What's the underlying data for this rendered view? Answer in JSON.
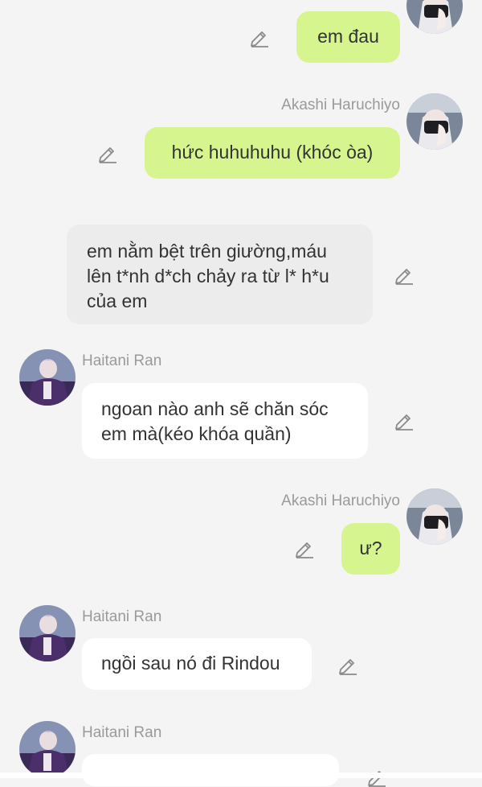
{
  "chat": {
    "messages": [
      {
        "sender": "",
        "text": "em đau",
        "style": "outgoing"
      },
      {
        "sender": "Akashi Haruchiyo",
        "text": "hức huhuhuhu (khóc òa)",
        "style": "outgoing"
      },
      {
        "sender": "",
        "text": "em nằm bệt trên giường,máu lên t*nh d*ch chảy ra từ l* h*u của em",
        "style": "narration"
      },
      {
        "sender": "Haitani Ran",
        "text": "ngoan nào anh sẽ chăn sóc em mà(kéo khóa quần)",
        "style": "incoming"
      },
      {
        "sender": "Akashi Haruchiyo",
        "text": "ư?",
        "style": "outgoing"
      },
      {
        "sender": "Haitani Ran",
        "text": "ngồi sau nó đi Rindou",
        "style": "incoming"
      },
      {
        "sender": "Haitani Ran",
        "text": "",
        "style": "incoming"
      }
    ]
  },
  "icons": {
    "edit": "pencil-icon",
    "avatar_akashi": "avatar-akashi-icon",
    "avatar_ran": "avatar-ran-icon"
  },
  "colors": {
    "background": "#f4f4f4",
    "outgoing_bubble": "#d6f58f",
    "incoming_bubble": "#ffffff",
    "narration_bubble": "#ececec",
    "name_text": "#9a9a9a",
    "message_text": "#333333",
    "icon": "#8a8a8a"
  }
}
